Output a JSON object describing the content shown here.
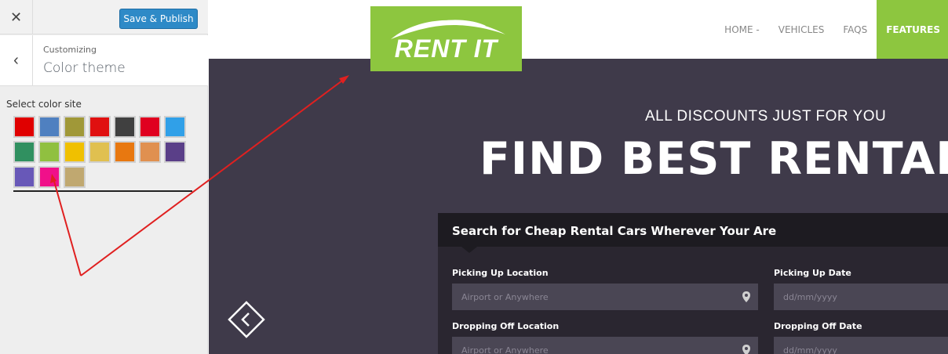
{
  "customizer": {
    "close_icon": "close-icon",
    "publish_label": "Save & Publish",
    "back_icon": "chevron-left-icon",
    "subtitle": "Customizing",
    "title": "Color theme",
    "select_label": "Select color site",
    "swatches": [
      "#e00000",
      "#4f80c0",
      "#a09838",
      "#e01010",
      "#404040",
      "#e00020",
      "#30a0e8",
      "#309060",
      "#90c040",
      "#f0c000",
      "#e0c050",
      "#e87810",
      "#e09050",
      "#5a3f88",
      "#6858b8",
      "#f0108a",
      "#c0a870"
    ]
  },
  "preview": {
    "logo": "RENT IT",
    "nav": [
      "HOME -",
      "VEHICLES",
      "FAQS",
      "FEATURES"
    ],
    "eyebrow": "ALL DISCOUNTS JUST FOR YOU",
    "headline": "FIND BEST RENTAL",
    "search": {
      "title": "Search for Cheap Rental Cars Wherever Your Are",
      "pickup_location_label": "Picking Up Location",
      "pickup_location_placeholder": "Airport or Anywhere",
      "pickup_date_label": "Picking Up Date",
      "pickup_date_placeholder": "dd/mm/yyyy",
      "dropoff_location_label": "Dropping Off Location",
      "dropoff_location_placeholder": "Airport or Anywhere",
      "dropoff_date_label": "Dropping Off Date",
      "dropoff_date_placeholder": "dd/mm/yyyy"
    },
    "colors": {
      "accent": "#8dc63f",
      "hero_bg": "#3f3a4a",
      "annotation": "#e02020"
    }
  }
}
